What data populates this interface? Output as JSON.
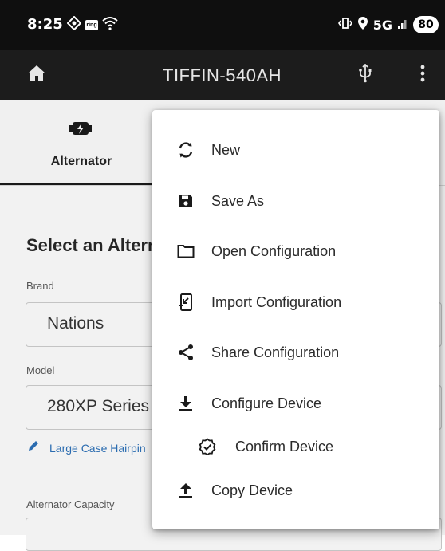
{
  "status_bar": {
    "time": "8:25",
    "ring_badge": "ring",
    "network": "5G",
    "battery": "80"
  },
  "app_bar": {
    "title": "TIFFIN-540AH",
    "icons": [
      "home-icon",
      "usb-icon",
      "more-vert-icon"
    ]
  },
  "tabs": {
    "alternator": {
      "label": "Alternator",
      "icon": "alternator-icon"
    }
  },
  "content": {
    "section_title": "Select an Alternator",
    "brand": {
      "label": "Brand",
      "value": "Nations"
    },
    "model": {
      "label": "Model",
      "value": "280XP Series"
    },
    "link": {
      "text": "Large Case Hairpin"
    },
    "capacity": {
      "label": "Alternator Capacity"
    }
  },
  "menu": {
    "items": [
      {
        "label": "New",
        "icon": "refresh-icon"
      },
      {
        "label": "Save As",
        "icon": "save-icon"
      },
      {
        "label": "Open Configuration",
        "icon": "folder-icon"
      },
      {
        "label": "Import Configuration",
        "icon": "import-icon"
      },
      {
        "label": "Share Configuration",
        "icon": "share-icon"
      },
      {
        "label": "Configure Device",
        "icon": "download-icon"
      },
      {
        "label": "Confirm Device",
        "icon": "verified-check-icon"
      },
      {
        "label": "Copy Device",
        "icon": "upload-icon"
      }
    ]
  },
  "colors": {
    "status_bar_bg": "#0f0f0f",
    "app_bar_bg": "#1c1c1c",
    "link_color": "#2b6cb0"
  }
}
